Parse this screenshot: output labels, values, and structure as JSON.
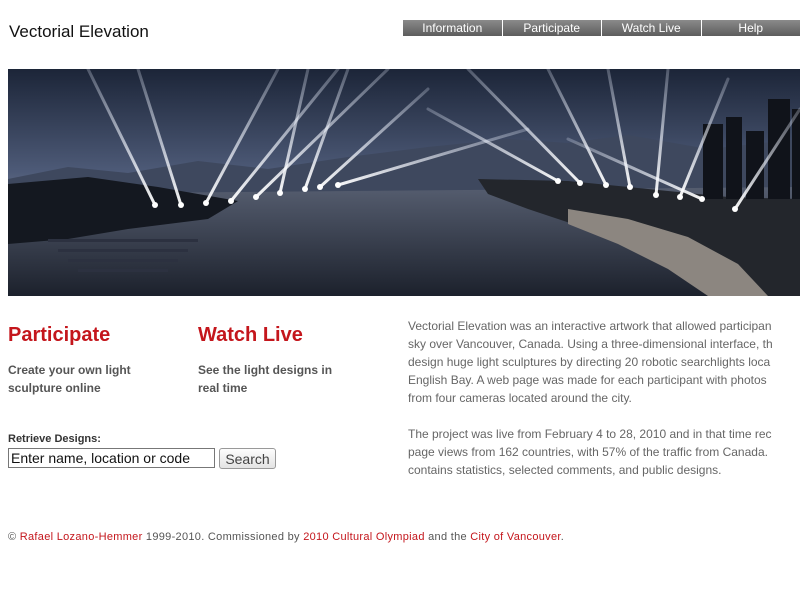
{
  "site": {
    "title": "Vectorial Elevation"
  },
  "nav": [
    "Information",
    "Participate",
    "Watch Live",
    "Help"
  ],
  "features": [
    {
      "title": "Participate",
      "desc_line1": "Create your own light",
      "desc_line2": "sculpture online"
    },
    {
      "title": "Watch Live",
      "desc_line1": "See the light designs in",
      "desc_line2": "real time"
    }
  ],
  "retrieve": {
    "label": "Retrieve Designs:",
    "value": "Enter name, location or code",
    "button": "Search"
  },
  "about": {
    "p1": [
      "Vectorial Elevation was an interactive artwork that allowed participan",
      "sky over Vancouver, Canada. Using a three-dimensional interface, th",
      "design huge light sculptures by directing 20 robotic searchlights loca",
      "English Bay. A web page was made for each participant with photos",
      "from four cameras located around the city."
    ],
    "p2": [
      "The project was live from February 4 to 28, 2010 and in that time rec",
      "page views from 162 countries, with 57% of the traffic from Canada.",
      "contains statistics, selected comments, and public designs."
    ]
  },
  "footer": {
    "copyright": "© ",
    "artist": "Rafael Lozano-Hemmer",
    "years": " 1999-2010. Commissioned by ",
    "olympiad": "2010 Cultural Olympiad",
    "and": " and the ",
    "city": "City of Vancouver",
    "end": "."
  }
}
